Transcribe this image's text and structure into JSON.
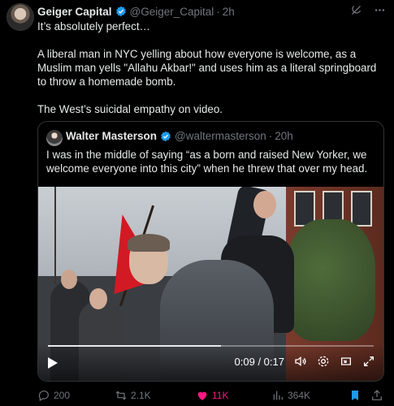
{
  "post": {
    "author_name": "Geiger Capital",
    "author_handle": "@Geiger_Capital",
    "separator": "·",
    "time": "2h",
    "text": "It’s absolutely perfect…\n\nA liberal man in NYC yelling about how everyone is welcome, as a Muslim man yells \"Allahu Akbar!\" and uses him as a literal springboard to throw a homemade bomb.\n\nThe West’s suicidal empathy on video."
  },
  "quote": {
    "author_name": "Walter Masterson",
    "author_handle": "@waltermasterson",
    "separator": "·",
    "time": "20h",
    "text": "I was in the middle of saying “as a born and raised New Yorker, we welcome everyone into this city” when he threw that over my head."
  },
  "video": {
    "time_display": "0:09 / 0:17",
    "progress": 0.53
  },
  "actions": {
    "replies": "200",
    "reposts": "2.1K",
    "likes": "11K",
    "views": "364K"
  },
  "colors": {
    "accent_blue": "#1d9bf0",
    "like_pink": "#f91880",
    "muted": "#71767b"
  },
  "icons": [
    "grok-icon",
    "more-icon",
    "verified-badge-icon",
    "play-icon",
    "volume-icon",
    "settings-icon",
    "pip-icon",
    "fullscreen-icon",
    "reply-icon",
    "repost-icon",
    "like-icon",
    "views-icon",
    "bookmark-icon",
    "share-icon"
  ]
}
